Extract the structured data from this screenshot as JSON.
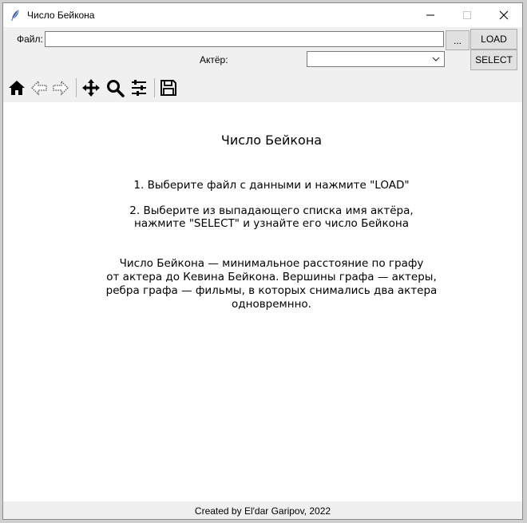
{
  "window": {
    "title": "Число Бейкона"
  },
  "file_row": {
    "label": "Файл:",
    "value": "",
    "browse_label": "...",
    "load_label": "LOAD"
  },
  "actor_row": {
    "label": "Актёр:",
    "selected": "",
    "select_label": "SELECT"
  },
  "toolbar": {
    "icons": [
      "home-icon",
      "back-arrow-icon",
      "forward-arrow-icon",
      "pan-icon",
      "zoom-icon",
      "configure-subplots-icon",
      "save-icon"
    ]
  },
  "canvas": {
    "heading": "Число Бейкона",
    "step1": "1. Выберите файл с данными и нажмите \"LOAD\"",
    "step2_line1": "2. Выберите из выпадающего списка имя актёра,",
    "step2_line2": "нажмите \"SELECT\" и узнайте его число Бейкона",
    "desc_line1": "Число Бейкона — минимальное расстояние по графу",
    "desc_line2": "от актера до Кевина Бейкона. Вершины графа — актеры,",
    "desc_line3": "ребра графа — фильмы, в которых снимались два актера",
    "desc_line4": "одновремнно."
  },
  "footer": {
    "text": "Created by El'dar Garipov, 2022"
  }
}
